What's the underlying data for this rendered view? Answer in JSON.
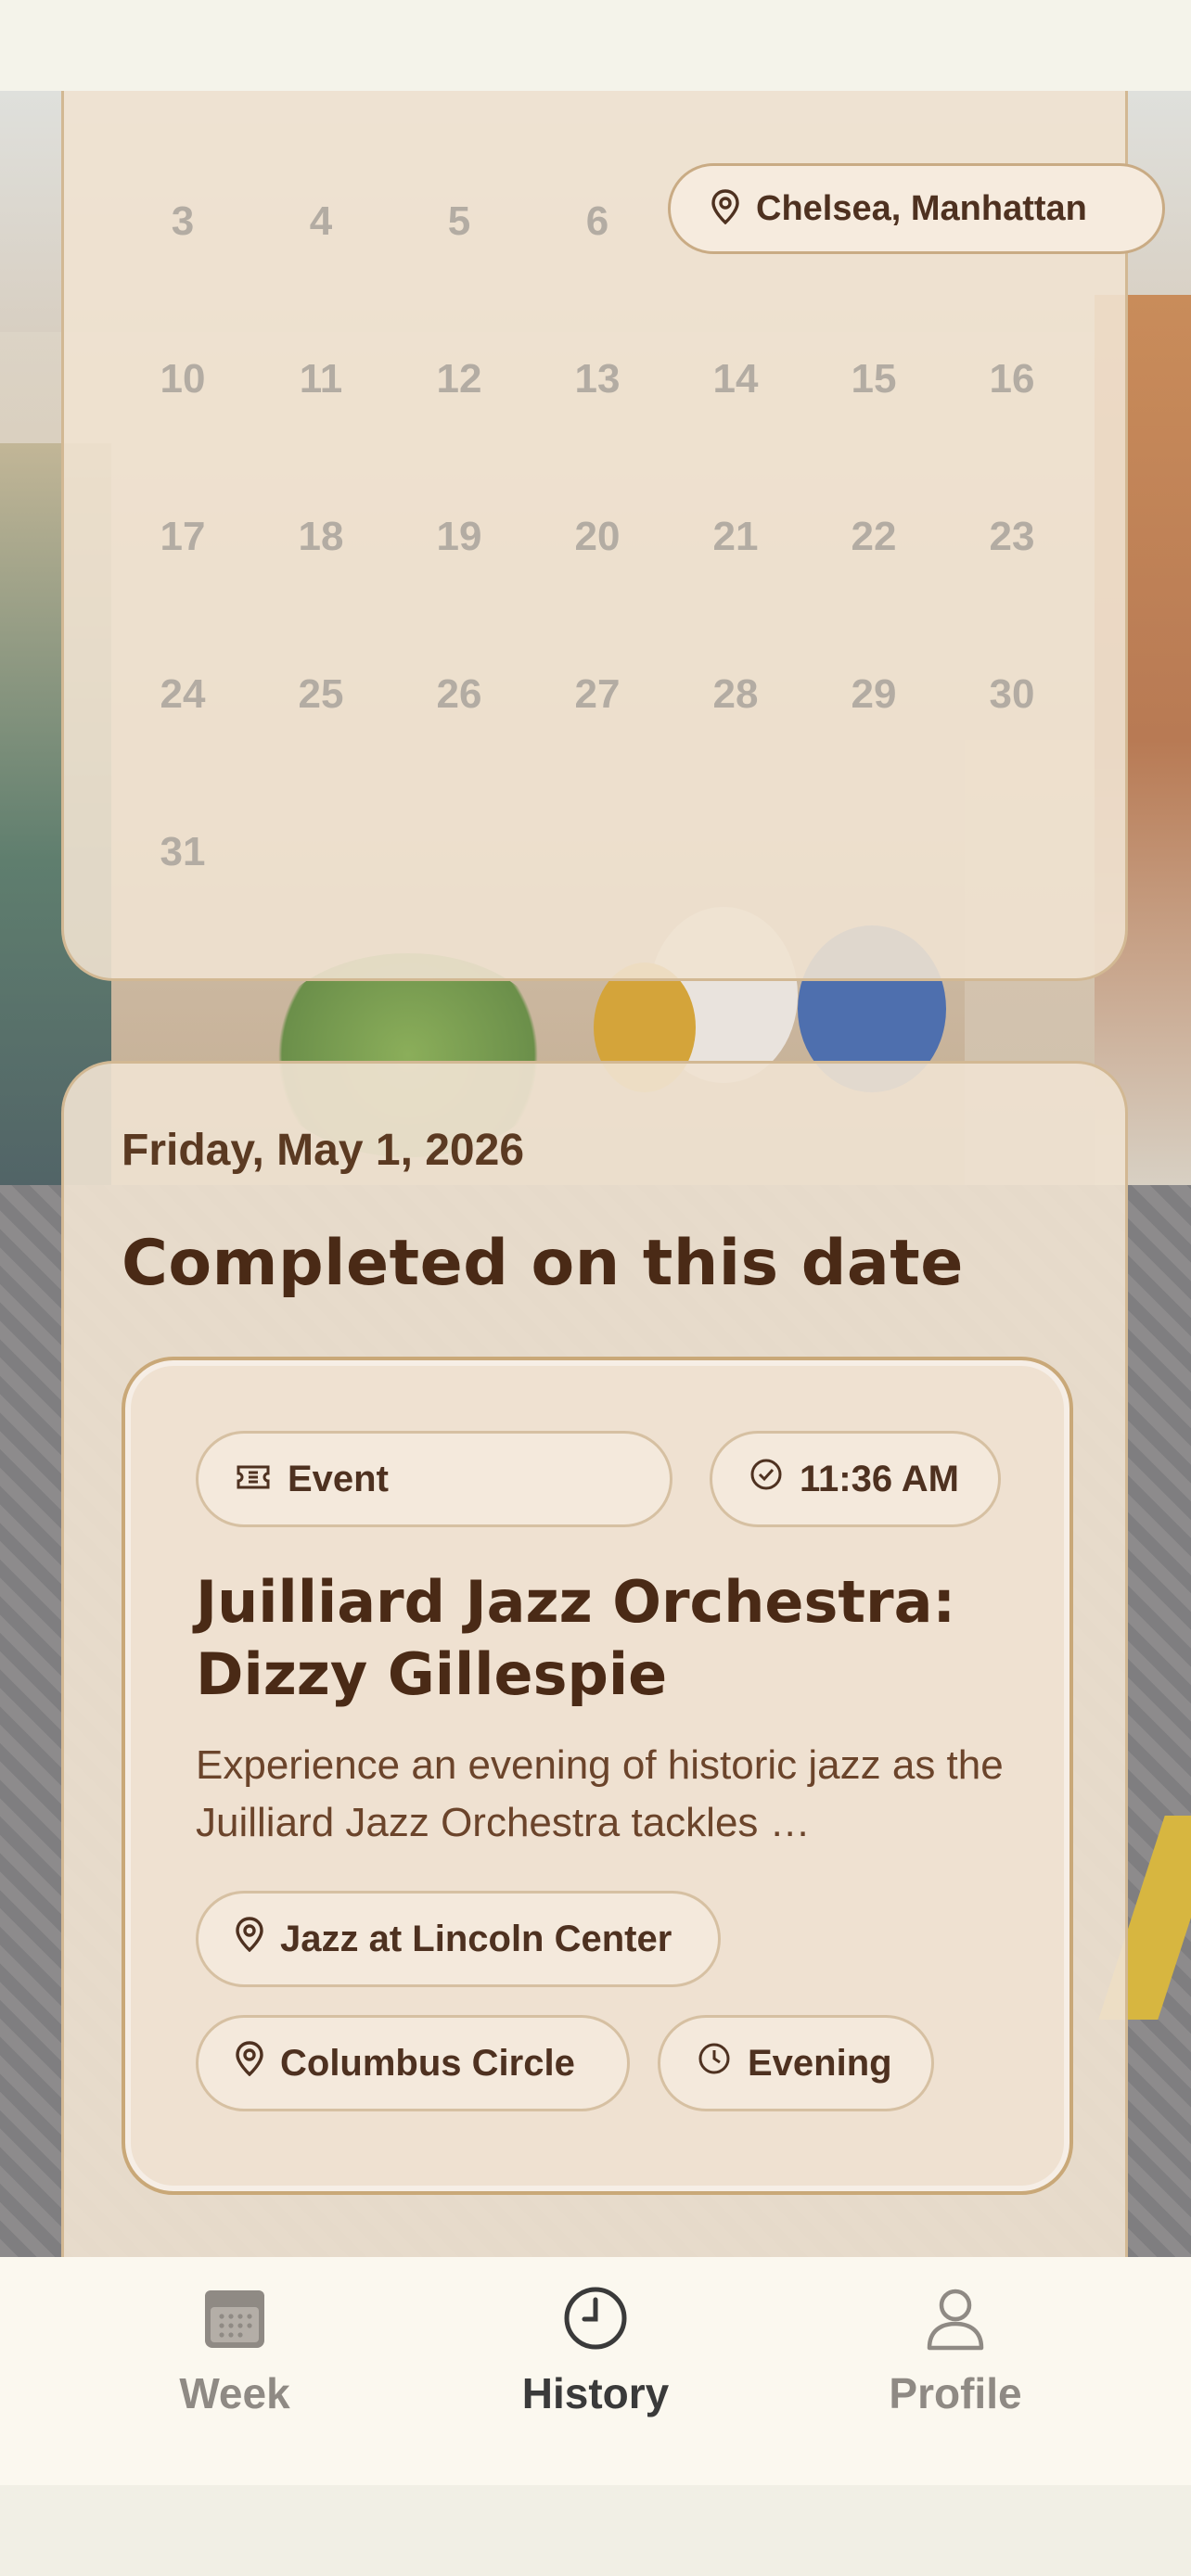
{
  "calendar": {
    "rows": [
      [
        "3",
        "4",
        "5",
        "6",
        "",
        "",
        ""
      ],
      [
        "10",
        "11",
        "12",
        "13",
        "14",
        "15",
        "16"
      ],
      [
        "17",
        "18",
        "19",
        "20",
        "21",
        "22",
        "23"
      ],
      [
        "24",
        "25",
        "26",
        "27",
        "28",
        "29",
        "30"
      ],
      [
        "31",
        "",
        "",
        "",
        "",
        "",
        ""
      ]
    ]
  },
  "location_pill": {
    "label": "Chelsea, Manhattan",
    "icon": "location-pin-icon"
  },
  "history": {
    "date": "Friday, May 1, 2026",
    "title": "Completed on this date",
    "card": {
      "type_label": "Event",
      "type_icon": "ticket-icon",
      "time": "11:36 AM",
      "time_icon": "check-circle-icon",
      "title": "Juilliard Jazz Orchestra: Dizzy Gillespie",
      "description": "Experience an evening of historic jazz as the Juilliard Jazz Orchestra tackles …",
      "venue": "Jazz at Lincoln Center",
      "neighborhood": "Columbus Circle",
      "time_of_day": "Evening"
    }
  },
  "tabs": [
    {
      "label": "Week",
      "icon": "calendar-icon",
      "active": false
    },
    {
      "label": "History",
      "icon": "clock-icon",
      "active": true
    },
    {
      "label": "Profile",
      "icon": "person-icon",
      "active": false
    }
  ],
  "colors": {
    "accent_dark": "#4a2a16",
    "panel": "#efe2d0",
    "border": "#c9a878",
    "muted_text": "#b3aca3",
    "tab_inactive": "#8f8a84"
  }
}
